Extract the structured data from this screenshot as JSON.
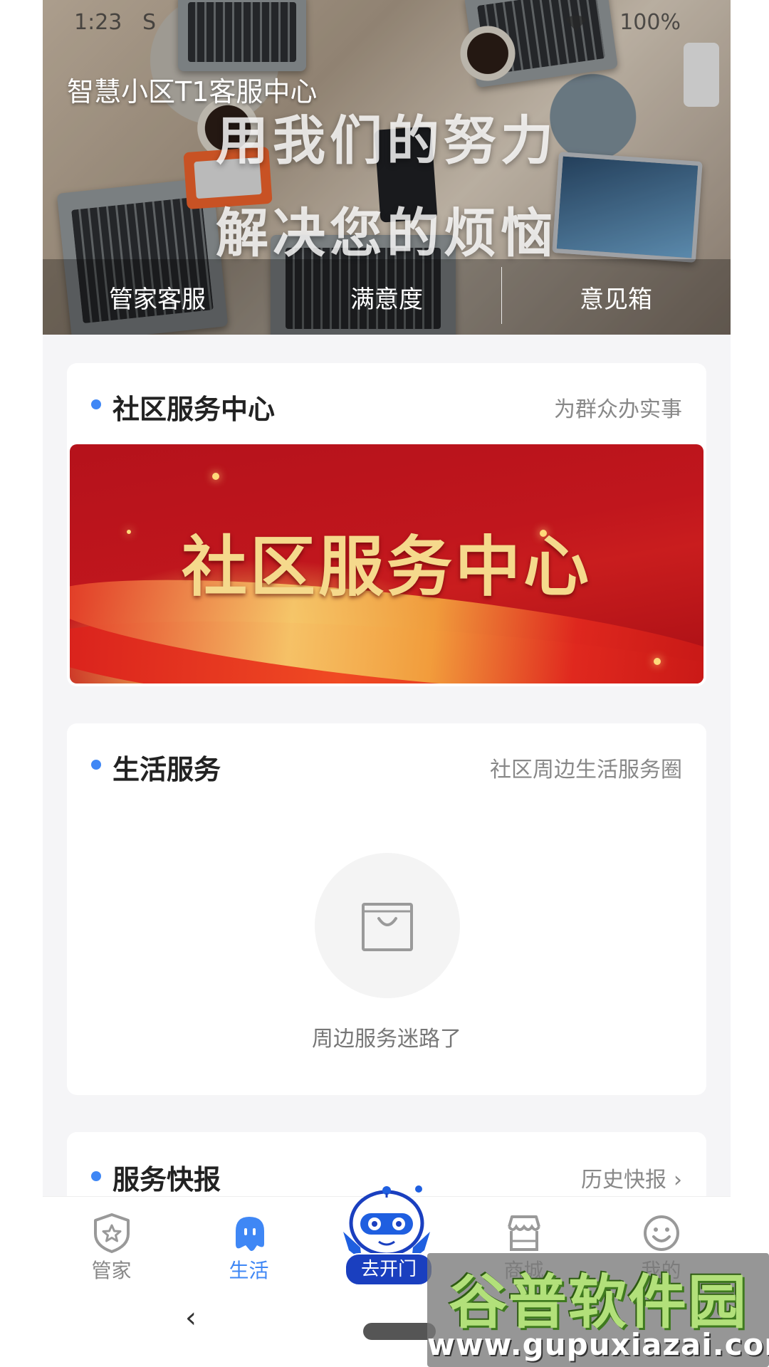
{
  "status_bar": {
    "time": "1:23",
    "carrier_icon": "S",
    "battery": "100%"
  },
  "hero": {
    "app_title": "智慧小区T1客服中心",
    "slogan_line1": "用我们的努力",
    "slogan_line2": "解决您的烦恼",
    "tabs": [
      {
        "label": "管家客服"
      },
      {
        "label": "满意度"
      },
      {
        "label": "意见箱"
      }
    ]
  },
  "community_center": {
    "title": "社区服务中心",
    "subtitle": "为群众办实事",
    "banner_text": "社区服务中心"
  },
  "life_service": {
    "title": "生活服务",
    "subtitle": "社区周边生活服务圈",
    "empty_text": "周边服务迷路了"
  },
  "news": {
    "title": "服务快报",
    "more_label": "历史快报",
    "more_icon": "chevron-right-icon"
  },
  "bottom_nav": {
    "items": [
      {
        "label": "管家",
        "icon": "shield-star-icon"
      },
      {
        "label": "生活",
        "icon": "ghost-life-icon"
      },
      {
        "label": "去开门",
        "icon": "robot-icon"
      },
      {
        "label": "商城",
        "icon": "store-icon"
      },
      {
        "label": "我的",
        "icon": "smiley-icon"
      }
    ],
    "active_color": "#3f87f5",
    "inactive_color": "#888888"
  },
  "system_nav": {
    "back_icon": "‹"
  },
  "watermark": {
    "title": "谷普软件园",
    "url": "www.gupuxiazai.com"
  },
  "colors": {
    "accent": "#3f87f5",
    "banner_red": "#c0161d",
    "gold_text": "#f5d98c"
  }
}
